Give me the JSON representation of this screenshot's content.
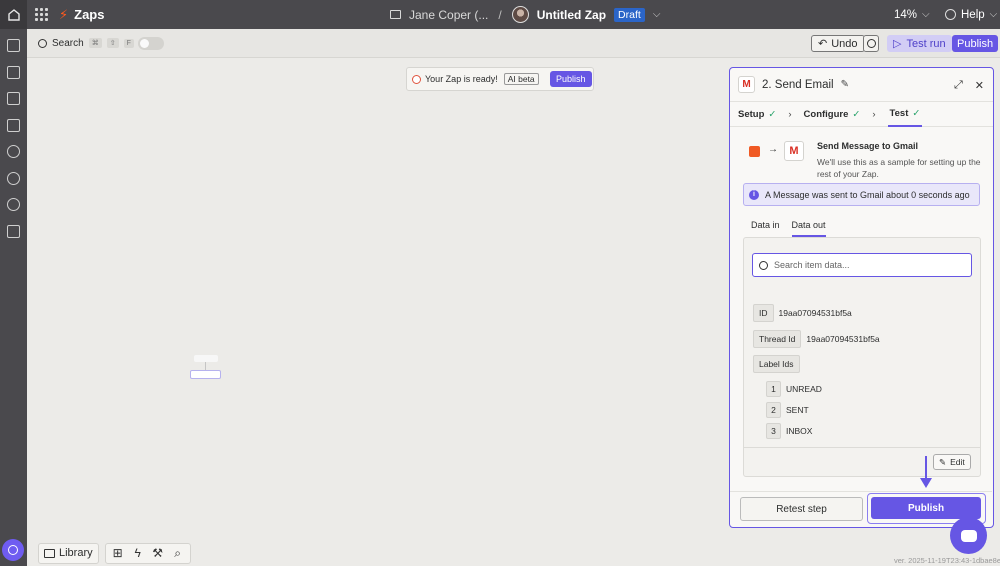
{
  "topbar": {
    "brand": "Zaps",
    "folder": "Jane Coper (...",
    "separator": "/",
    "zap_name": "Untitled Zap",
    "status": "Draft",
    "zoom": "14%",
    "help": "Help"
  },
  "toolbar": {
    "search_label": "Search",
    "kbd": [
      "⌘",
      "⇧",
      "F"
    ],
    "undo": "Undo",
    "test_run": "Test run",
    "publish": "Publish"
  },
  "canvas": {
    "ready_text": "Your Zap is ready!",
    "ai_beta": "AI beta",
    "ready_publish": "Publish"
  },
  "bottom": {
    "library": "Library"
  },
  "version": "ver. 2025-11-19T23:43-1dbae8e5",
  "panel": {
    "title": "2. Send Email",
    "tabs": [
      {
        "label": "Setup",
        "done": "✓"
      },
      {
        "label": "Configure",
        "done": "✓"
      },
      {
        "label": "Test",
        "done": "✓"
      }
    ],
    "send_title": "Send Message to Gmail",
    "send_desc": "We'll use this as a sample for setting up the rest of your Zap.",
    "info": "A Message was sent to Gmail about 0 seconds ago",
    "data_tabs": [
      "Data in",
      "Data out"
    ],
    "search_placeholder": "Search item data...",
    "fields": {
      "id_label": "ID",
      "id_value": "19aa07094531bf5a",
      "thread_label": "Thread Id",
      "thread_value": "19aa07094531bf5a",
      "label_ids": "Label Ids",
      "labels": [
        {
          "idx": "1",
          "value": "UNREAD"
        },
        {
          "idx": "2",
          "value": "SENT"
        },
        {
          "idx": "3",
          "value": "INBOX"
        }
      ]
    },
    "edit": "Edit",
    "retest": "Retest step",
    "publish": "Publish"
  },
  "colors": {
    "accent": "#6656e4",
    "topbar": "#4a494d",
    "canvas": "#ecebe8",
    "draft": "#2b65c8",
    "bolt": "#ff5a1f"
  }
}
